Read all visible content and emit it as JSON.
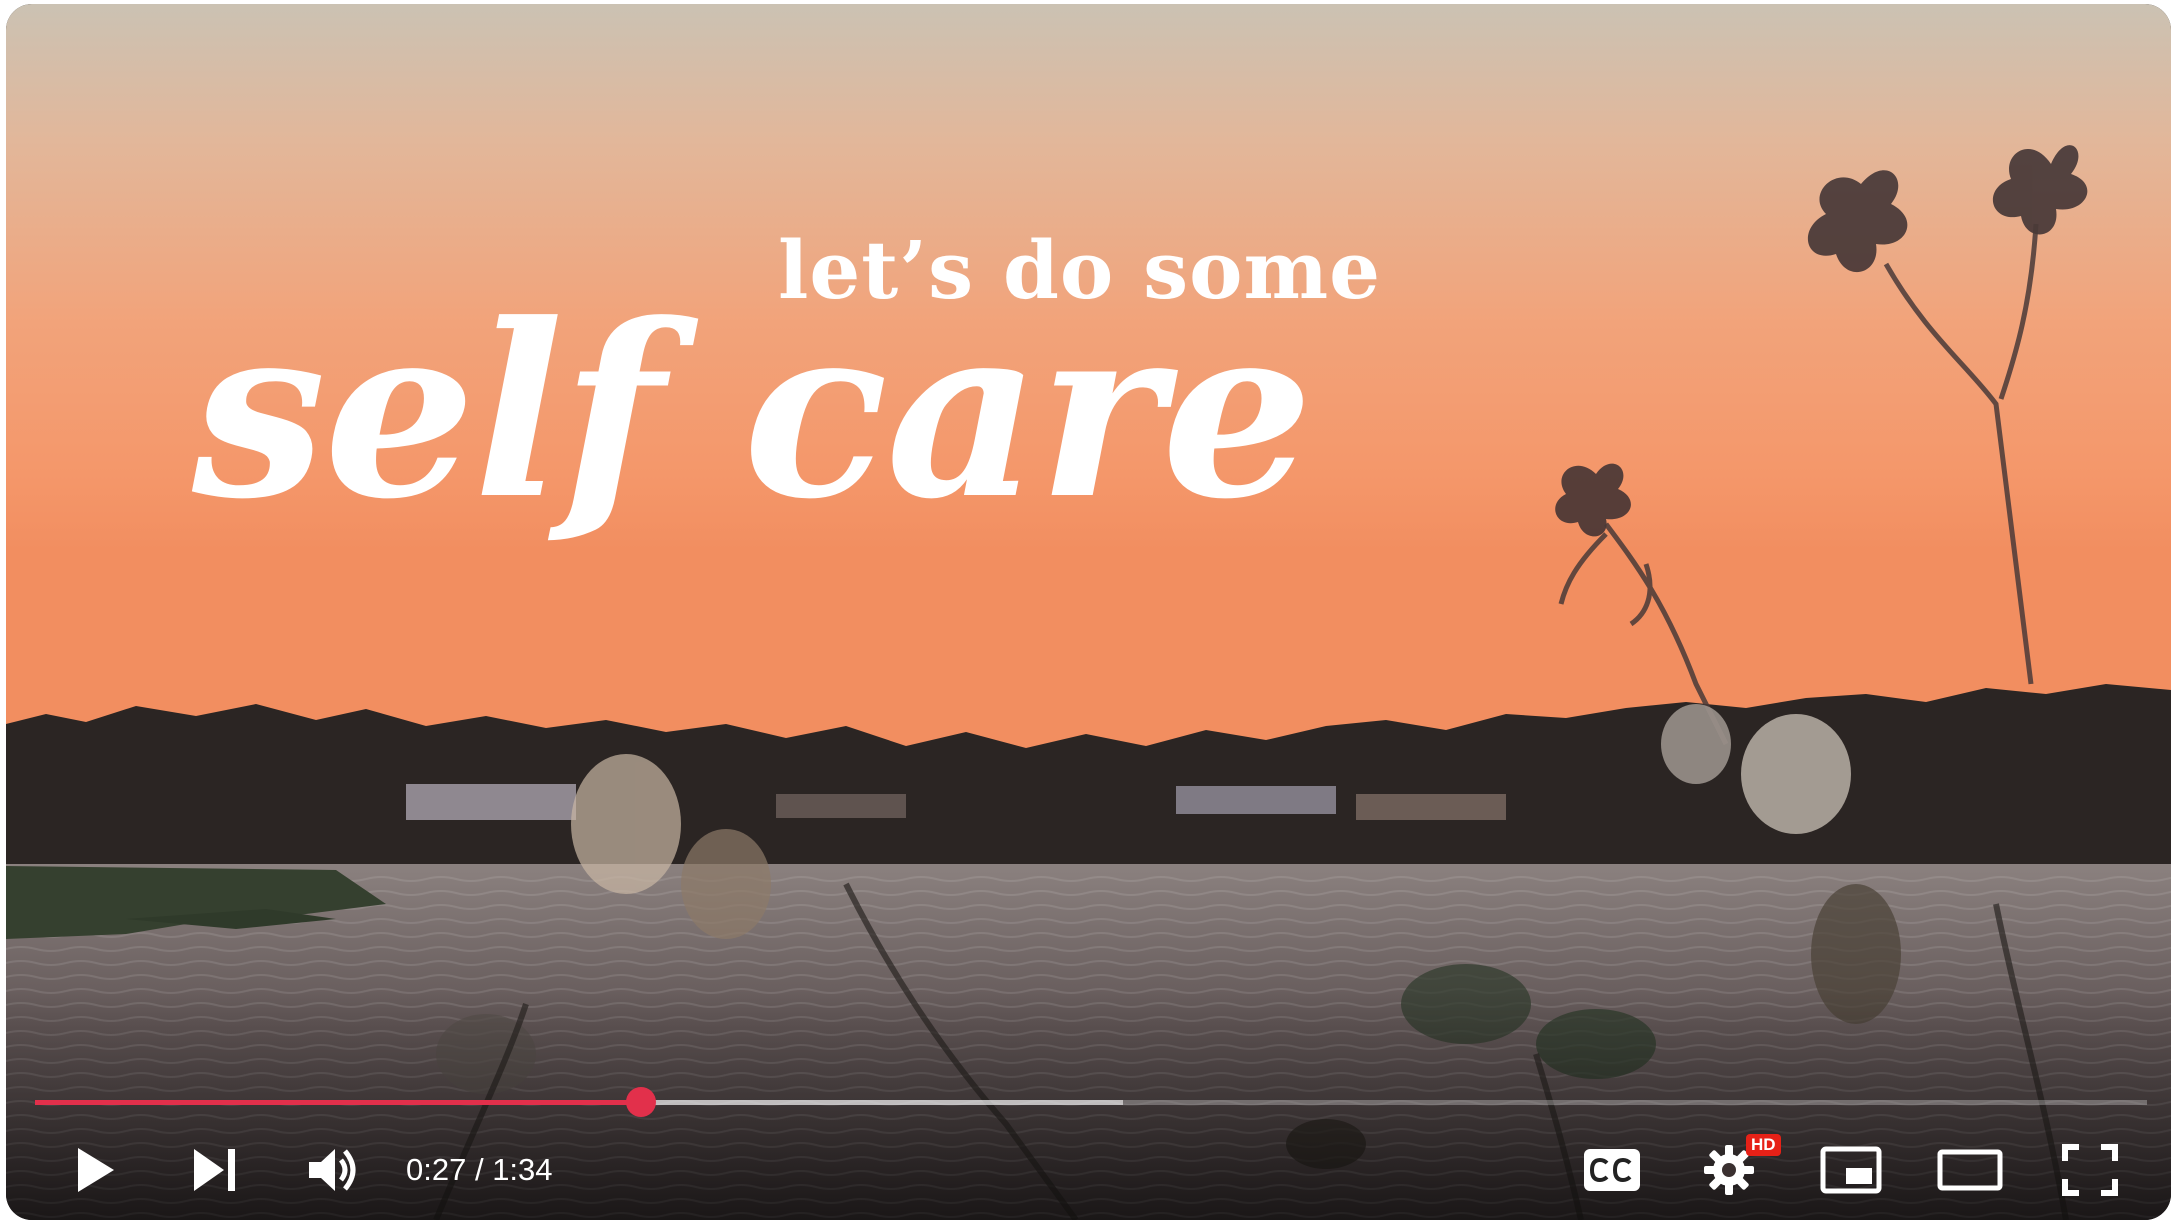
{
  "video": {
    "overlay_line1": "let’s do some",
    "overlay_line2": "self care"
  },
  "player": {
    "current_time": "0:27",
    "separator": " / ",
    "duration": "1:34",
    "played_fraction": 0.287,
    "buffered_fraction": 0.515,
    "quality_badge": "HD",
    "accent_color": "#e2304b"
  },
  "icons": [
    "play-icon",
    "next-icon",
    "volume-icon",
    "captions-icon",
    "settings-icon",
    "miniplayer-icon",
    "theater-mode-icon",
    "fullscreen-icon"
  ]
}
